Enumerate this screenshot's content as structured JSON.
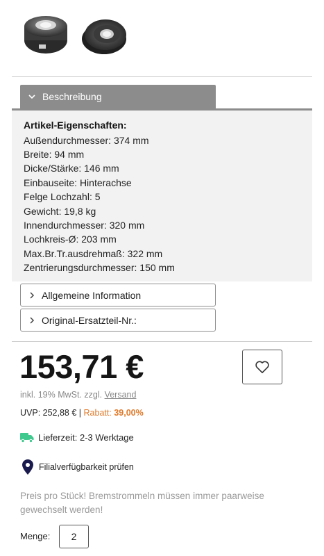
{
  "gallery": {
    "images": [
      {
        "icon": "brake-drum-front-view"
      },
      {
        "icon": "brake-drum-angled-view"
      }
    ]
  },
  "description_tab": {
    "label": "Beschreibung",
    "icon": "chevron-down-icon"
  },
  "properties": {
    "heading": "Artikel-Eigenschaften:",
    "rows": [
      "Außendurchmesser: 374 mm",
      "Breite: 94 mm",
      "Dicke/Stärke: 146 mm",
      "Einbauseite: Hinterachse",
      "Felge Lochzahl: 5",
      "Gewicht: 19,8 kg",
      "Innendurchmesser: 320 mm",
      "Lochkreis-Ø: 203 mm",
      "Max.Br.Tr.ausdrehmaß: 322 mm",
      "Zentrierungsdurchmesser: 150 mm"
    ]
  },
  "accordions": [
    {
      "label": "Allgemeine Information",
      "icon": "chevron-right-icon"
    },
    {
      "label": "Original-Ersatzteil-Nr.:",
      "icon": "chevron-right-icon"
    }
  ],
  "price": {
    "amount": "153,71 €",
    "tax_prefix": "inkl. 19% MwSt. zzgl.",
    "shipping_link": "Versand"
  },
  "uvp": {
    "label": "UVP: 252,88 €",
    "separator": " | ",
    "rabatt_label": "Rabatt:",
    "rabatt_value": "39,00%",
    "rabatt_color": "#e07a2a"
  },
  "delivery": {
    "text": "Lieferzeit: 2-3 Werktage",
    "icon": "truck-icon",
    "icon_color": "#3fc98f"
  },
  "store": {
    "text": "Filialverfügbarkeit prüfen",
    "icon": "location-pin-icon",
    "icon_color": "#1a1a4e"
  },
  "note": "Preis pro Stück! Bremstrommeln müssen immer paarweise gewechselt werden!",
  "quantity": {
    "label": "Menge:",
    "value": "2"
  },
  "wishlist": {
    "icon": "heart-icon"
  }
}
